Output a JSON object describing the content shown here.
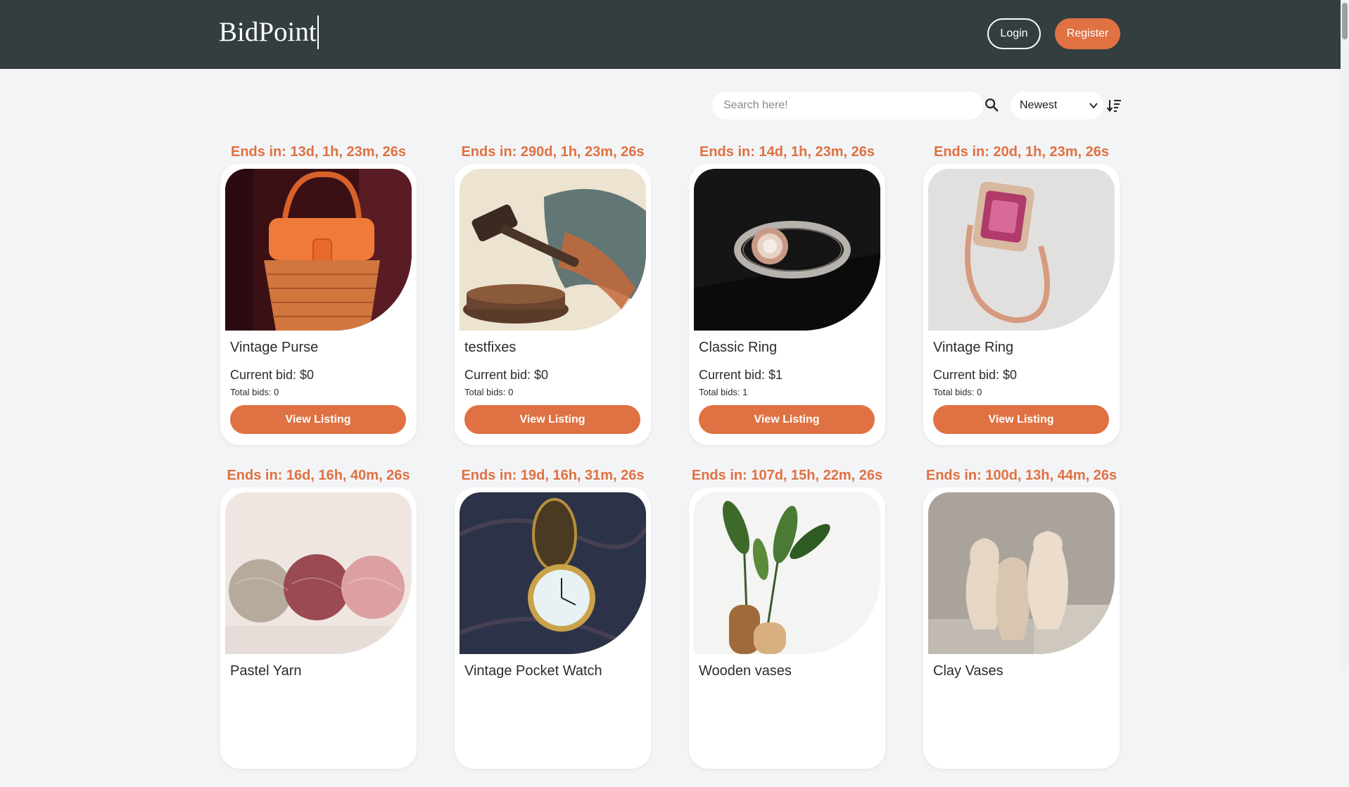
{
  "header": {
    "logo": "BidPoint",
    "login_label": "Login",
    "register_label": "Register"
  },
  "toolbar": {
    "search_placeholder": "Search here!",
    "sort_value": "Newest",
    "search_icon": "search-icon",
    "sort_icon": "sort-descending-icon"
  },
  "listings": [
    {
      "timer": "Ends in: 13d, 1h, 23m, 26s",
      "title": "Vintage Purse",
      "current_bid": "Current bid: $0",
      "total_bids": "Total bids: 0",
      "button": "View Listing"
    },
    {
      "timer": "Ends in: 290d, 1h, 23m, 26s",
      "title": "testfixes",
      "current_bid": "Current bid: $0",
      "total_bids": "Total bids: 0",
      "button": "View Listing"
    },
    {
      "timer": "Ends in: 14d, 1h, 23m, 26s",
      "title": "Classic Ring",
      "current_bid": "Current bid: $1",
      "total_bids": "Total bids: 1",
      "button": "View Listing"
    },
    {
      "timer": "Ends in: 20d, 1h, 23m, 26s",
      "title": "Vintage Ring",
      "current_bid": "Current bid: $0",
      "total_bids": "Total bids: 0",
      "button": "View Listing"
    },
    {
      "timer": "Ends in: 16d, 16h, 40m, 26s",
      "title": "Pastel Yarn",
      "current_bid": "",
      "total_bids": "",
      "button": ""
    },
    {
      "timer": "Ends in: 19d, 16h, 31m, 26s",
      "title": "Vintage Pocket Watch",
      "current_bid": "",
      "total_bids": "",
      "button": ""
    },
    {
      "timer": "Ends in: 107d, 15h, 22m, 26s",
      "title": "Wooden vases",
      "current_bid": "",
      "total_bids": "",
      "button": ""
    },
    {
      "timer": "Ends in: 100d, 13h, 44m, 26s",
      "title": "Clay Vases",
      "current_bid": "",
      "total_bids": "",
      "button": ""
    }
  ],
  "colors": {
    "header_bg": "#343e40",
    "accent": "#e07142",
    "page_bg": "#f3f4f6"
  }
}
